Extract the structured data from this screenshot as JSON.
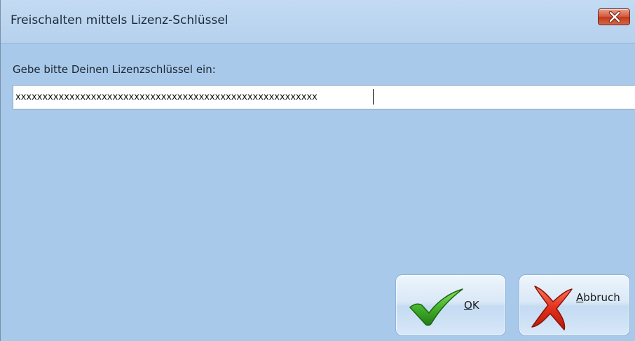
{
  "window": {
    "title": "Freischalten mittels Lizenz-Schlüssel"
  },
  "form": {
    "prompt": "Gebe bitte Deinen Lizenzschlüssel ein:",
    "license_key_value": "xxxxxxxxxxxxxxxxxxxxxxxxxxxxxxxxxxxxxxxxxxxxxxxxxxxxxxxx"
  },
  "buttons": {
    "ok": {
      "mnemonic": "O",
      "rest": "K",
      "icon": "checkmark-icon"
    },
    "cancel": {
      "mnemonic": "A",
      "rest": "bbruch",
      "icon": "red-x-icon"
    },
    "close": {
      "icon": "close-icon"
    }
  },
  "colors": {
    "background": "#a9c9ea",
    "close_button": "#d65a3e",
    "check_green": "#3fa82b",
    "cross_red": "#e0301e"
  }
}
